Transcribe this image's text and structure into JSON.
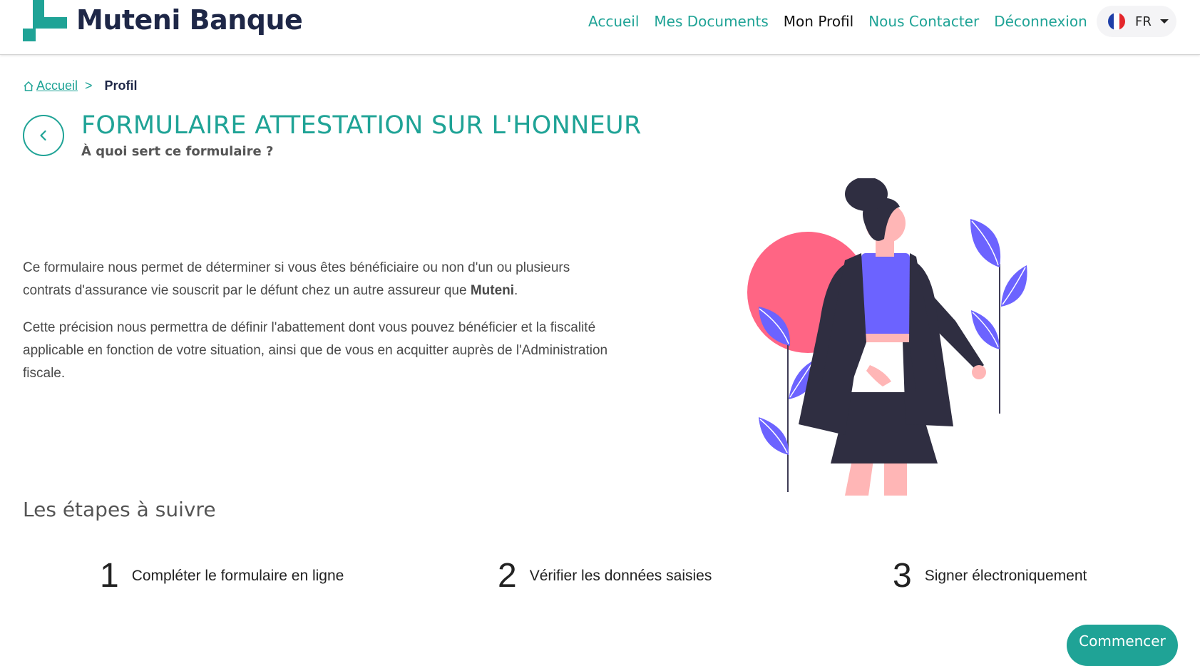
{
  "brand": {
    "name": "Muteni Banque"
  },
  "nav": {
    "items": [
      {
        "label": "Accueil",
        "active": false
      },
      {
        "label": "Mes Documents",
        "active": false
      },
      {
        "label": "Mon Profil",
        "active": true
      },
      {
        "label": "Nous Contacter",
        "active": false
      },
      {
        "label": "Déconnexion",
        "active": false
      }
    ]
  },
  "language": {
    "code": "FR",
    "flag": "france-flag-icon"
  },
  "breadcrumb": {
    "home": "Accueil",
    "separator": ">",
    "current": "Profil"
  },
  "page": {
    "title": "FORMULAIRE ATTESTATION SUR L'HONNEUR",
    "subtitle": "À quoi sert ce formulaire ?",
    "paragraph1_before": "Ce formulaire nous permet de déterminer si vous êtes bénéficiaire ou non d'un ou plusieurs contrats d'assurance vie souscrit par le défunt chez un autre assureur que ",
    "paragraph1_bold": "Muteni",
    "paragraph1_after": ".",
    "paragraph2": "Cette précision nous permettra de définir l'abattement dont vous pouvez bénéficier et la fiscalité applicable en fonction de votre situation, ainsi que de vous en acquitter auprès de l'Administration fiscale."
  },
  "steps": {
    "title": "Les étapes à suivre",
    "items": [
      {
        "number": "1",
        "label": "Compléter le formulaire en ligne"
      },
      {
        "number": "2",
        "label": "Vérifier les données saisies"
      },
      {
        "number": "3",
        "label": "Signer électroniquement"
      }
    ]
  },
  "actions": {
    "start_label": "Commencer"
  },
  "colors": {
    "accent": "#1fa396",
    "brand_text": "#1e2747",
    "illustration_circle": "#ff6584",
    "illustration_purple": "#6c63ff",
    "illustration_dark": "#2f2e41",
    "illustration_skin": "#ffb6b6"
  }
}
